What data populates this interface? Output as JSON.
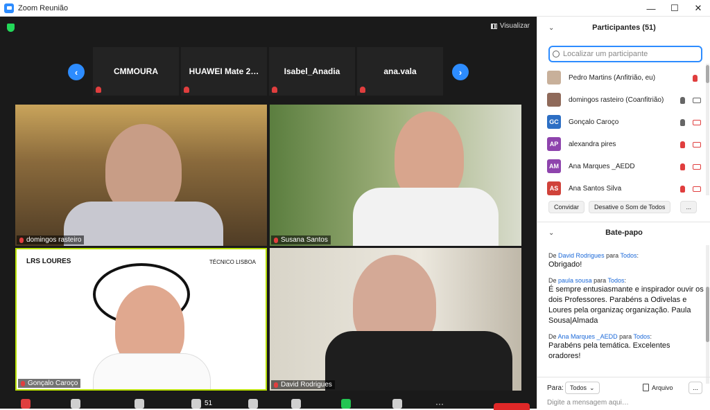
{
  "window": {
    "title": "Zoom Reunião",
    "controls": [
      "—",
      "☐",
      "✕"
    ]
  },
  "meeting": {
    "view_label": "Visualizar",
    "strip": [
      "CMMOURA",
      "HUAWEI Mate 2…",
      "Isabel_Anadia",
      "ana.vala"
    ],
    "videos": [
      "domingos rasteiro",
      "Susana Santos",
      "Gonçalo Caroço",
      "David Rodrigues"
    ],
    "slide_logo_left": "LRS LOURES",
    "slide_logo_right": "TÉCNICO LISBOA",
    "participants_count": "51"
  },
  "participants": {
    "header": "Participantes (51)",
    "search_placeholder": "Localizar um participante",
    "list": [
      {
        "name": "Pedro Martins (Anfitrião, eu)",
        "initials": "",
        "color": "#c8b09a"
      },
      {
        "name": "domingos rasteiro (Coanfitrião)",
        "initials": "",
        "color": "#8f6a5a"
      },
      {
        "name": "Gonçalo Caroço",
        "initials": "GC",
        "color": "#2d6fc4"
      },
      {
        "name": "alexandra pires",
        "initials": "AP",
        "color": "#8e44ad"
      },
      {
        "name": "Ana Marques _AEDD",
        "initials": "AM",
        "color": "#8e44ad"
      },
      {
        "name": "Ana Santos Silva",
        "initials": "AS",
        "color": "#d0423a"
      }
    ],
    "buttons": {
      "invite": "Convidar",
      "unmute_all": "Desative o Som de Todos",
      "more": "..."
    }
  },
  "chat": {
    "header": "Bate-papo",
    "messages": [
      {
        "prefix": "De",
        "from": "David Rodrigues",
        "mid": "para",
        "to": "Todos",
        "suffix": ":",
        "text": "Obrigado!"
      },
      {
        "prefix": "De",
        "from": "paula sousa",
        "mid": "para",
        "to": "Todos",
        "suffix": ":",
        "text": "É sempre entusiasmante e inspirador ouvir os dois Professores. Parabéns a Odivelas e Loures pela organizaç organização. Paula Sousa|Almada"
      },
      {
        "prefix": "De",
        "from": "Ana Marques _AEDD",
        "mid": "para",
        "to": "Todos",
        "suffix": ":",
        "text": "Parabéns pela temática. Excelentes oradores!"
      }
    ],
    "to_label": "Para:",
    "to_value": "Todos",
    "file_label": "Arquivo",
    "more": "...",
    "input_placeholder": "Digite a mensagem aqui…"
  }
}
